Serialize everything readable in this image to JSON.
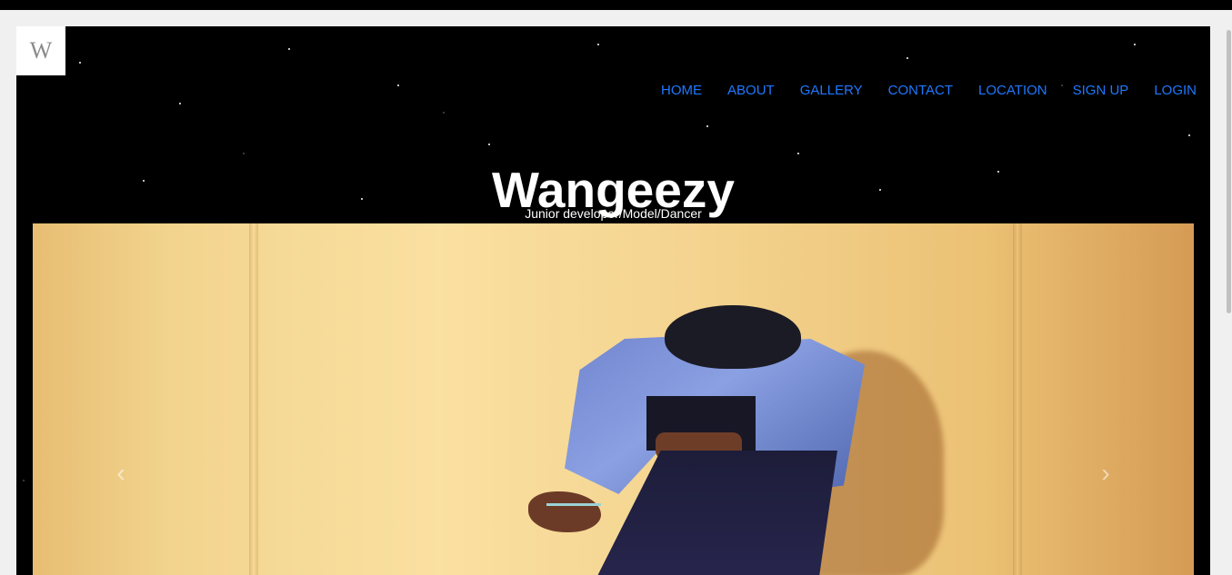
{
  "logo": {
    "text": "W",
    "icon": "monogram-logo-icon"
  },
  "nav": {
    "items": [
      {
        "label": "HOME"
      },
      {
        "label": "ABOUT"
      },
      {
        "label": "GALLERY"
      },
      {
        "label": "CONTACT"
      },
      {
        "label": "LOCATION"
      },
      {
        "label": "SIGN UP"
      },
      {
        "label": "LOGIN"
      }
    ],
    "color": "#1e78ff"
  },
  "hero": {
    "title": "Wangeezy",
    "subtitle": "Junior developer/Model/Dancer"
  },
  "carousel": {
    "prev_icon": "chevron-left-icon",
    "next_icon": "chevron-right-icon"
  },
  "colors": {
    "background": "#000000",
    "page_gutter": "#f0f0f0",
    "text": "#ffffff"
  }
}
